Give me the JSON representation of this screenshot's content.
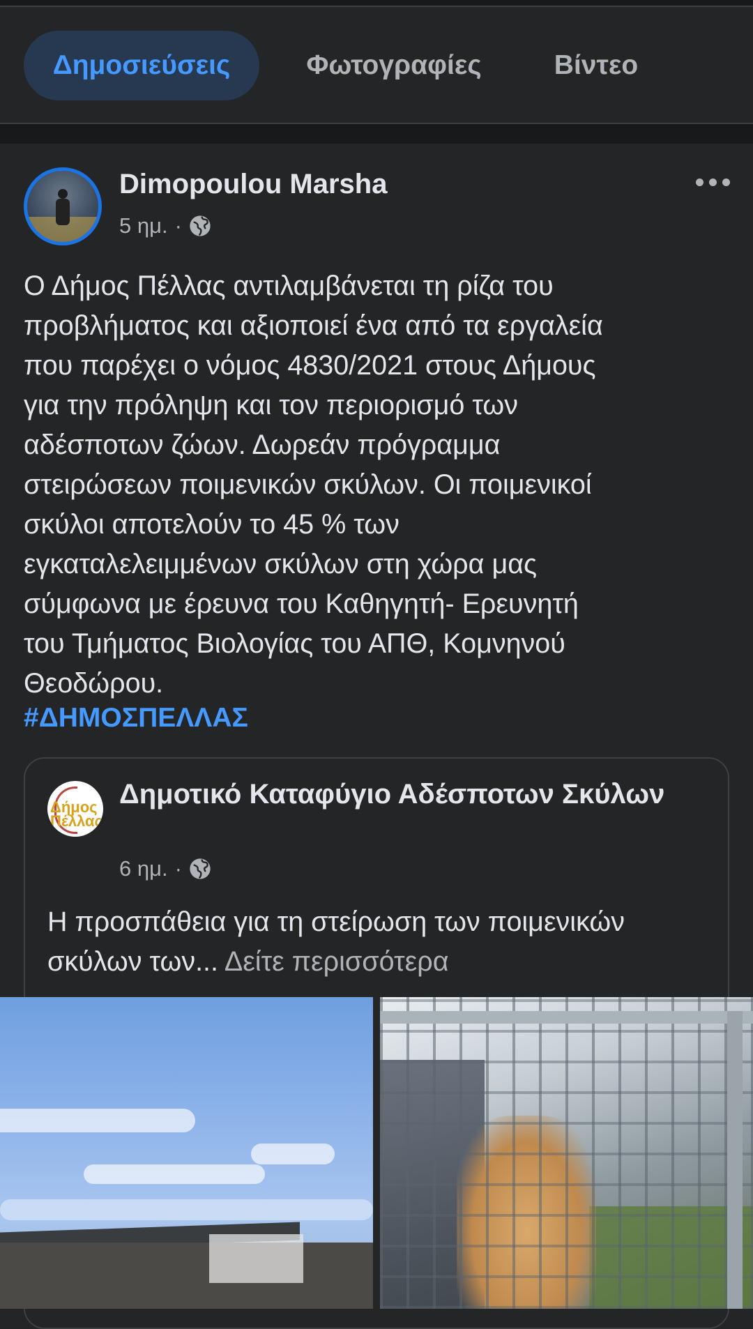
{
  "tabs": [
    {
      "label": "Δημοσιεύσεις",
      "active": true
    },
    {
      "label": "Φωτογραφίες",
      "active": false
    },
    {
      "label": "Βίντεο",
      "active": false
    }
  ],
  "post": {
    "author": "Dimopoulou Marsha",
    "time": "5 ημ.",
    "separator": "·",
    "audience_icon": "globe-icon",
    "text": "Ο Δήμος Πέλλας αντιλαμβάνεται τη ρίζα του\nπροβλήματος και  αξιοποιεί ένα από τα εργαλεία\nπου παρέχει ο νόμος 4830/2021 στους Δήμους\nγια την πρόληψη και τον περιορισμό των\nαδέσποτων ζώων. Δωρεάν πρόγραμμα\nστειρώσεων ποιμενικών σκύλων. Οι ποιμενικοί\nσκύλοι αποτελούν το 45 % των\nεγκαταλελειμμένων σκύλων στη χώρα μας\nσύμφωνα με έρευνα του Καθηγητή- Ερευνητή\nτου Τμήματος Βιολογίας του  ΑΠΘ, Κομνηνού\nΘεοδώρου.",
    "hashtag": "#ΔΗΜΟΣΠΕΛΛΑΣ"
  },
  "shared_post": {
    "page_name": "Δημοτικό Καταφύγιο Αδέσποτων Σκύλων",
    "time": "6 ημ.",
    "separator": "·",
    "logo_text": "Δήμος Πέλλας",
    "text": "Η προσπάθεια για τη στείρωση των ποιμενικών σκύλων των...",
    "see_more": "Δείτε περισσότερα"
  },
  "colors": {
    "background": "#242526",
    "accent": "#4599ff",
    "active_tab_bg": "#263951",
    "secondary_text": "#b0b3b8"
  }
}
